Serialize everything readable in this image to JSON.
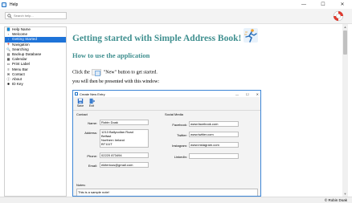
{
  "window": {
    "title": "Help",
    "controls": {
      "minimize": "—",
      "maximize": "☐",
      "close": "✕"
    }
  },
  "toolbar": {
    "search_placeholder": "Search help..."
  },
  "sidebar": {
    "items": [
      {
        "label": "Help Name",
        "icon": "book-icon",
        "glyph": "📘",
        "selected": false
      },
      {
        "label": "Welcome",
        "icon": "page-icon",
        "glyph": "▫",
        "selected": false
      },
      {
        "label": "Getting Started",
        "icon": "page-icon",
        "glyph": "▫",
        "selected": true
      },
      {
        "label": "Navigation",
        "icon": "pin-icon",
        "glyph": "📍",
        "selected": false
      },
      {
        "label": "Searching",
        "icon": "search-icon",
        "glyph": "🔍",
        "selected": false
      },
      {
        "label": "Backup Database",
        "icon": "database-icon",
        "glyph": "▤",
        "selected": false
      },
      {
        "label": "Calendar",
        "icon": "calendar-icon",
        "glyph": "▦",
        "selected": false
      },
      {
        "label": "Print Label",
        "icon": "label-icon",
        "glyph": "▭",
        "selected": false
      },
      {
        "label": "Menu Bar",
        "icon": "menu-icon",
        "glyph": "≡",
        "selected": false
      },
      {
        "label": "Contact",
        "icon": "contact-icon",
        "glyph": "✉",
        "selected": false
      },
      {
        "label": "About",
        "icon": "info-icon",
        "glyph": "ⓘ",
        "selected": false
      },
      {
        "label": "ID Key",
        "icon": "key-icon",
        "glyph": "✱",
        "selected": false
      }
    ]
  },
  "content": {
    "heading": "Getting started with Simple Address Book!",
    "subheading": "How to use the application",
    "para1_before": "Click the",
    "para1_after": "\"New\" button to get started.",
    "para2": "you will then be presented with this window:"
  },
  "dialog": {
    "title": "Create New Entry",
    "tools": [
      {
        "label": "Save"
      },
      {
        "label": "Exit"
      }
    ],
    "contact_group": "Contact",
    "social_group": "Social Media",
    "fields": {
      "name_label": "Name:",
      "name": "Robin Doak",
      "address_label": "Address:",
      "address": "1213 Ballycollan Road\nBelfast\nNorthern Ireland\nBT111T",
      "phone_label": "Phone:",
      "phone": "02220 873494",
      "email_label": "Email:",
      "email": "ekiterious@gmail.com",
      "facebook_label": "Facebook:",
      "facebook": "www.facebook.com",
      "twitter_label": "Twitter:",
      "twitter": "www.twitter.com",
      "instagram_label": "Instagram:",
      "instagram": "www.instagram.com",
      "linkedin_label": "LinkedIn:",
      "linkedin": ""
    },
    "notes_label": "Notes:",
    "notes": "This is a sample note!"
  },
  "status": {
    "text": "© Robin Doak"
  },
  "colors": {
    "heading": "#3f8f8f",
    "selection": "#1e73d8",
    "dialog_border": "#3d86d6"
  }
}
